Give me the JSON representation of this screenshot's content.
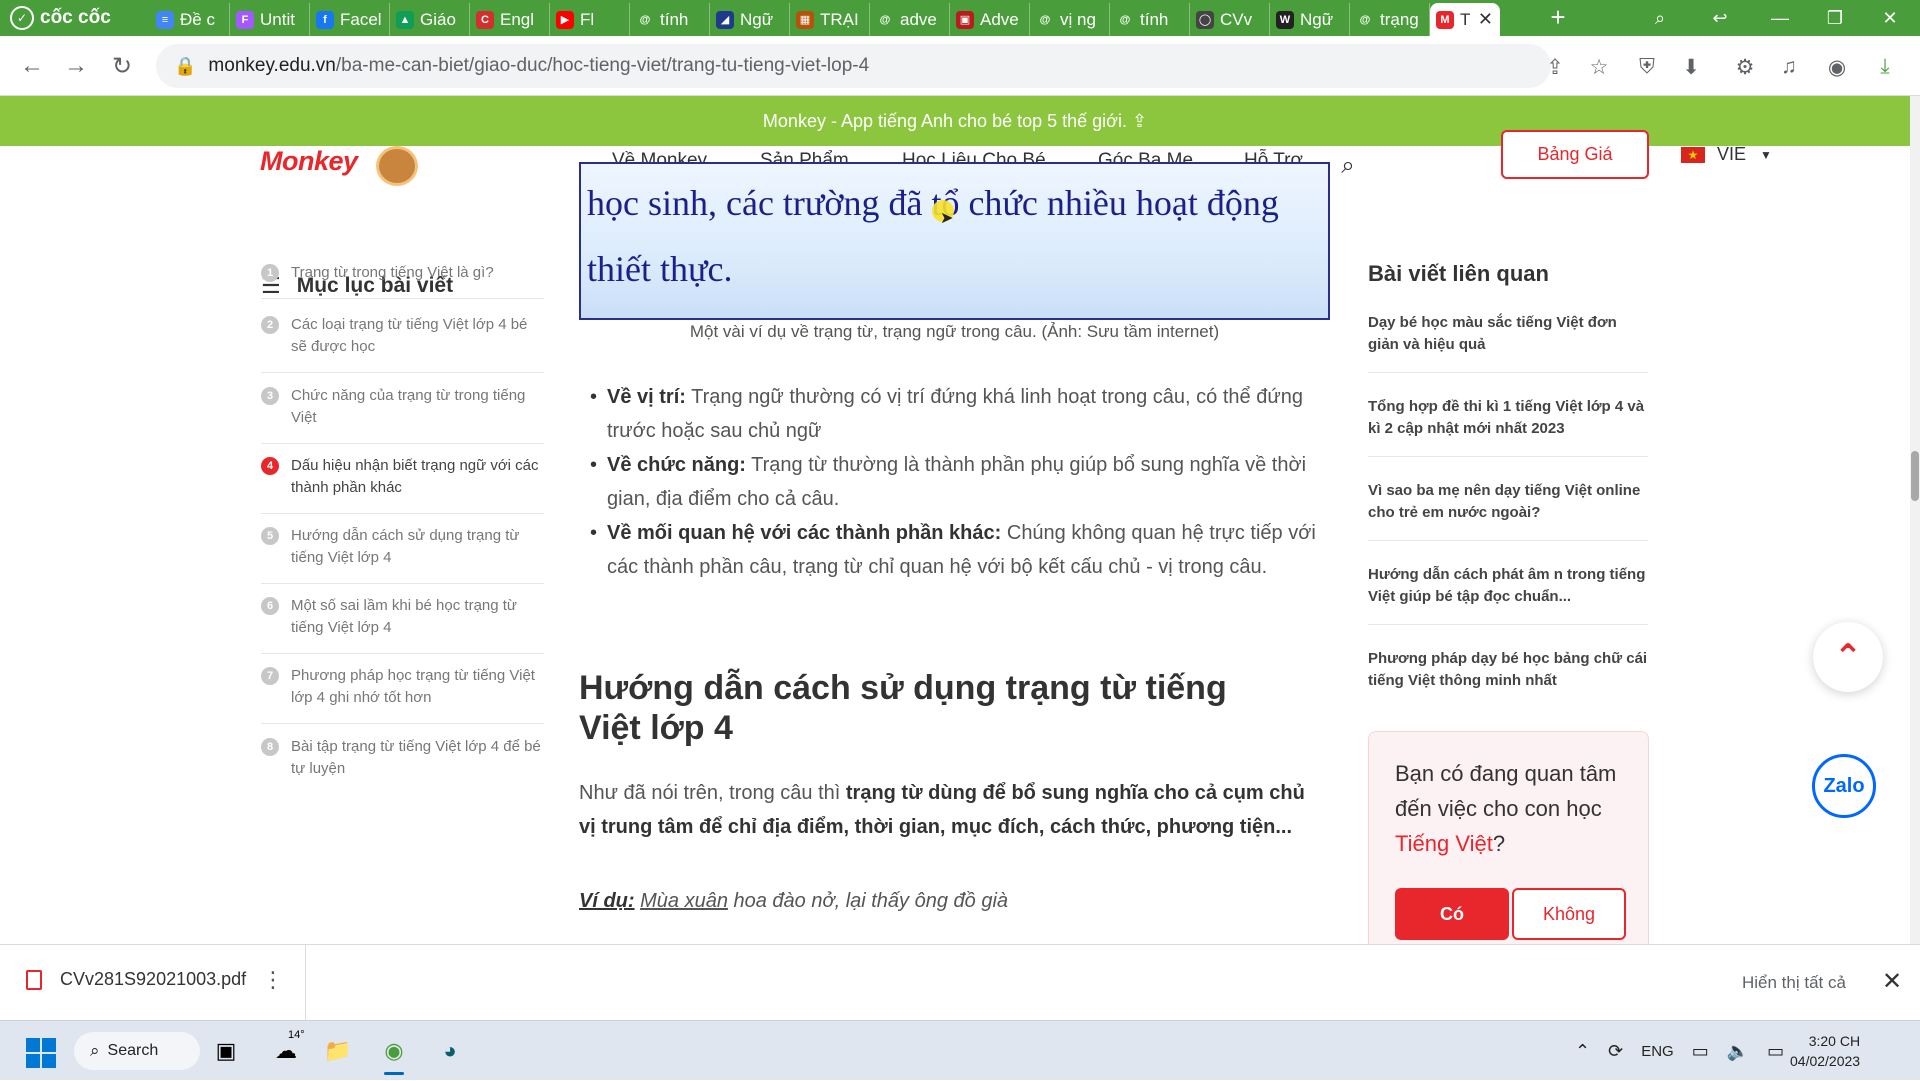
{
  "browser": {
    "name": "cốc cốc",
    "tabs": [
      {
        "label": "Đề c",
        "color": "#4285f4",
        "glyph": "≡"
      },
      {
        "label": "Untit",
        "color": "#a259ff",
        "glyph": "F"
      },
      {
        "label": "Facel",
        "color": "#1877f2",
        "glyph": "f"
      },
      {
        "label": "Giáo",
        "color": "#0f9d58",
        "glyph": "▲"
      },
      {
        "label": "Engl",
        "color": "#d32f2f",
        "glyph": "C"
      },
      {
        "label": "Fl",
        "color": "#ff0000",
        "glyph": "▶"
      },
      {
        "label": "tính",
        "color": "#4a9d3b",
        "glyph": "@"
      },
      {
        "label": "Ngữ",
        "color": "#1e3a8a",
        "glyph": "◢"
      },
      {
        "label": "TRẠI",
        "color": "#b45309",
        "glyph": "▦"
      },
      {
        "label": "adve",
        "color": "#4a9d3b",
        "glyph": "@"
      },
      {
        "label": "Adve",
        "color": "#b91c1c",
        "glyph": "▣"
      },
      {
        "label": "vị ng",
        "color": "#4a9d3b",
        "glyph": "@"
      },
      {
        "label": "tính",
        "color": "#4a9d3b",
        "glyph": "@"
      },
      {
        "label": "CVv",
        "color": "#444444",
        "glyph": "◯"
      },
      {
        "label": "Ngữ",
        "color": "#222222",
        "glyph": "W"
      },
      {
        "label": "trạng",
        "color": "#4a9d3b",
        "glyph": "@"
      }
    ],
    "active_tab": {
      "label": "T",
      "close": "✕"
    },
    "new_tab": "+",
    "url_host": "monkey.edu.vn",
    "url_path": "/ba-me-can-biet/giao-duc/hoc-tieng-viet/trang-tu-tieng-viet-lop-4"
  },
  "page": {
    "promo": "Monkey - App tiếng Anh cho bé top 5 thế giới. ⇪",
    "logo": "Monkey",
    "nav": [
      "Về Monkey",
      "Sản Phẩm",
      "Học Liệu Cho Bé",
      "Góc Ba Mẹ",
      "Hỗ Trợ"
    ],
    "price_button": "Bảng Giá",
    "language": "VIE",
    "image_lines": [
      "học sinh,  các trường đã tổ chức nhiều hoạt động",
      "thiết thực."
    ],
    "caption": "Một vài ví dụ về trạng từ, trạng ngữ trong câu. (Ảnh: Sưu tầm internet)",
    "toc_title": "Mục lục bài viết",
    "toc": [
      {
        "num": "1",
        "text": "Trạng từ trong tiếng Việt là gì?"
      },
      {
        "num": "2",
        "text": "Các loại trạng từ tiếng Việt lớp 4 bé sẽ được học"
      },
      {
        "num": "3",
        "text": "Chức năng của trạng từ trong tiếng Việt"
      },
      {
        "num": "4",
        "text": "Dấu hiệu nhận biết trạng ngữ với các thành phần khác"
      },
      {
        "num": "5",
        "text": "Hướng dẫn cách sử dụng trạng từ tiếng Việt lớp 4"
      },
      {
        "num": "6",
        "text": "Một số sai lầm khi bé học trạng từ tiếng Việt lớp 4"
      },
      {
        "num": "7",
        "text": "Phương pháp học trạng từ tiếng Việt lớp 4 ghi nhớ tốt hơn"
      },
      {
        "num": "8",
        "text": "Bài tập trạng từ tiếng Việt lớp 4 để bé tự luyện"
      }
    ],
    "bullets": [
      {
        "label": "Về vị trí:",
        "text": " Trạng ngữ thường có vị trí đứng khá linh hoạt trong câu, có thể đứng trước hoặc sau chủ ngữ"
      },
      {
        "label": "Về chức năng:",
        "text": " Trạng từ thường là thành phần phụ giúp bổ sung nghĩa về thời gian, địa điểm cho cả câu."
      },
      {
        "label": "Về mối quan hệ với các thành phần khác:",
        "text": " Chúng không quan hệ trực tiếp với các thành phần câu,  trạng từ chỉ quan hệ với bộ kết cấu chủ - vị trong câu."
      }
    ],
    "section_heading": "Hướng dẫn cách sử dụng trạng từ tiếng Việt lớp 4",
    "para_lead": "Như đã nói trên, trong câu thì ",
    "para_bold": "trạng từ dùng để bổ sung nghĩa cho cả cụm chủ vị trung tâm để chỉ địa điểm, thời gian, mục đích, cách thức, phương tiện...",
    "example_label": "Ví dụ:",
    "example_underlined": "Mùa xuân",
    "example_rest": " hoa đào nở, lại thấy ông đồ già",
    "related_title": "Bài viết liên quan",
    "related": [
      "Dạy bé học màu sắc tiếng Việt đơn giản và hiệu quả",
      "Tổng hợp đề thi kì 1 tiếng Việt lớp 4 và kì 2 cập nhật mới nhất 2023",
      "Vì sao ba mẹ nên dạy tiếng Việt online cho trẻ em nước ngoài?",
      "Hướng dẫn cách phát âm n trong tiếng Việt giúp bé tập đọc chuẩn...",
      "Phương pháp dạy bé học bảng chữ cái tiếng Việt thông minh nhất"
    ],
    "cta_text": "Bạn có đang quan tâm đến việc cho con học ",
    "cta_highlight": "Tiếng Việt",
    "cta_end": "?",
    "cta_yes": "Có",
    "cta_no": "Không",
    "zalo": "Zalo"
  },
  "downloads": {
    "file": "CVv281S92021003.pdf",
    "show_all": "Hiển thị tất cả"
  },
  "taskbar": {
    "search": "Search",
    "weather": "14°",
    "lang": "ENG",
    "time": "3:20 CH",
    "date": "04/02/2023"
  },
  "colors": {
    "brand_red": "#e8272d",
    "promo_green": "#8cc63f",
    "browser_green": "#4a9d3b"
  }
}
